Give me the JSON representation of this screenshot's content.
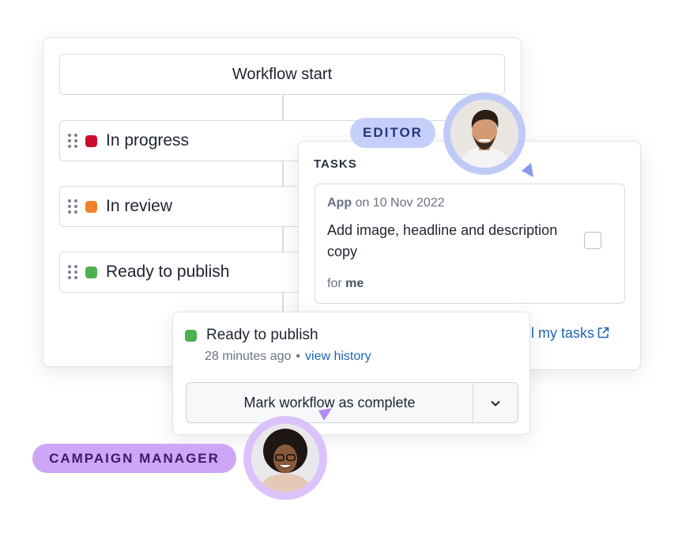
{
  "workflow": {
    "start_label": "Workflow start",
    "stages": [
      {
        "label": "In progress",
        "color": "#c8102e"
      },
      {
        "label": "In review",
        "color": "#f0822e"
      },
      {
        "label": "Ready to publish",
        "color": "#4caf50"
      }
    ]
  },
  "tasks_panel": {
    "title": "TASKS",
    "task": {
      "source": "App",
      "date_text": "on 10 Nov 2022",
      "description": "Add image, headline and description copy",
      "assignee_prefix": "for",
      "assignee": "me"
    },
    "all_tasks_link": "all my tasks"
  },
  "status_panel": {
    "status_label": "Ready to publish",
    "status_color": "#4caf50",
    "time_ago": "28 minutes ago",
    "separator": "•",
    "view_history_link": "view history",
    "complete_button_label": "Mark workflow as complete",
    "dropdown_icon": "chevron-down-icon"
  },
  "roles": {
    "editor_label": "EDITOR",
    "editor_color": "#c4d0fa",
    "campaign_manager_label": "CAMPAIGN MANAGER",
    "campaign_manager_color": "#cda7f6"
  }
}
